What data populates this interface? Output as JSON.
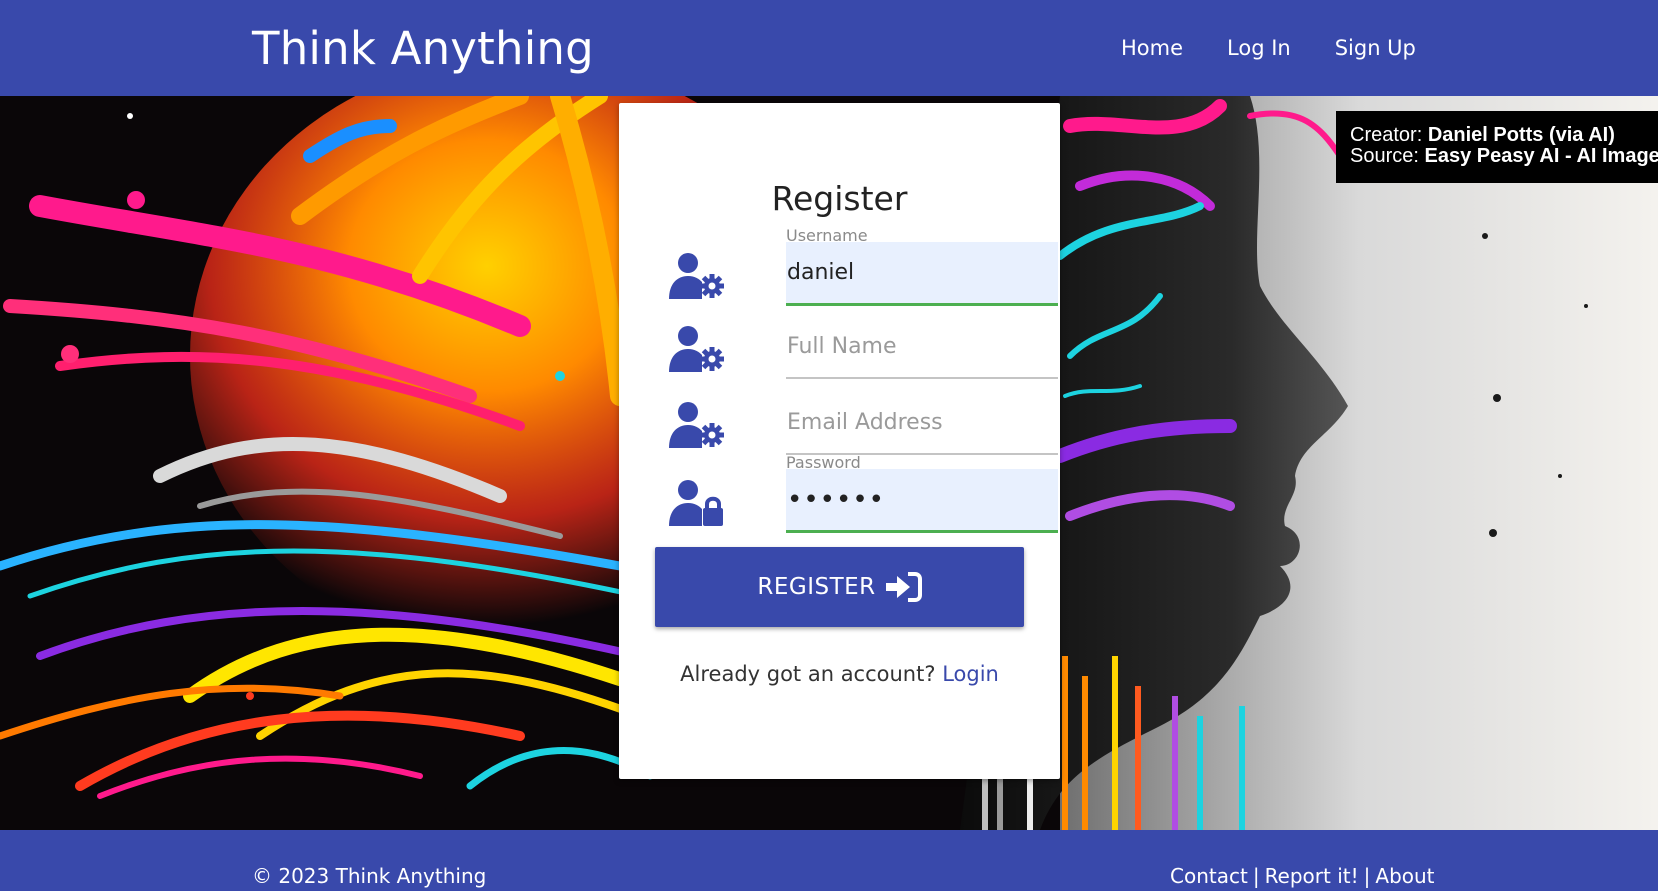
{
  "header": {
    "brand": "Think Anything",
    "nav": [
      {
        "label": "Home"
      },
      {
        "label": "Log In"
      },
      {
        "label": "Sign Up"
      }
    ]
  },
  "image_credit": {
    "creator_label": "Creator:",
    "creator_value": "Daniel Potts (via AI)",
    "source_label": "Source:",
    "source_value": "Easy Peasy AI - AI Image"
  },
  "register_form": {
    "title": "Register",
    "fields": [
      {
        "icon": "user-gear-icon",
        "label": "Username",
        "value": "daniel",
        "placeholder": "Username"
      },
      {
        "icon": "user-gear-icon",
        "label": "",
        "value": "",
        "placeholder": "Full Name"
      },
      {
        "icon": "user-gear-icon",
        "label": "",
        "value": "",
        "placeholder": "Email Address"
      },
      {
        "icon": "user-lock-icon",
        "label": "Password",
        "value": "••••••",
        "placeholder": "Password"
      }
    ],
    "submit_label": "REGISTER",
    "submit_icon": "sign-in-icon",
    "login_prompt": "Already got an account?",
    "login_link": "Login"
  },
  "footer": {
    "copyright": "© 2023 Think Anything",
    "links": [
      {
        "label": "Contact"
      },
      {
        "label": "Report it!"
      },
      {
        "label": "About"
      }
    ],
    "separator": "|"
  },
  "colors": {
    "brand_blue": "#3949ab",
    "autofill_bg": "#e8f0fe",
    "valid_green": "#4caf50"
  }
}
